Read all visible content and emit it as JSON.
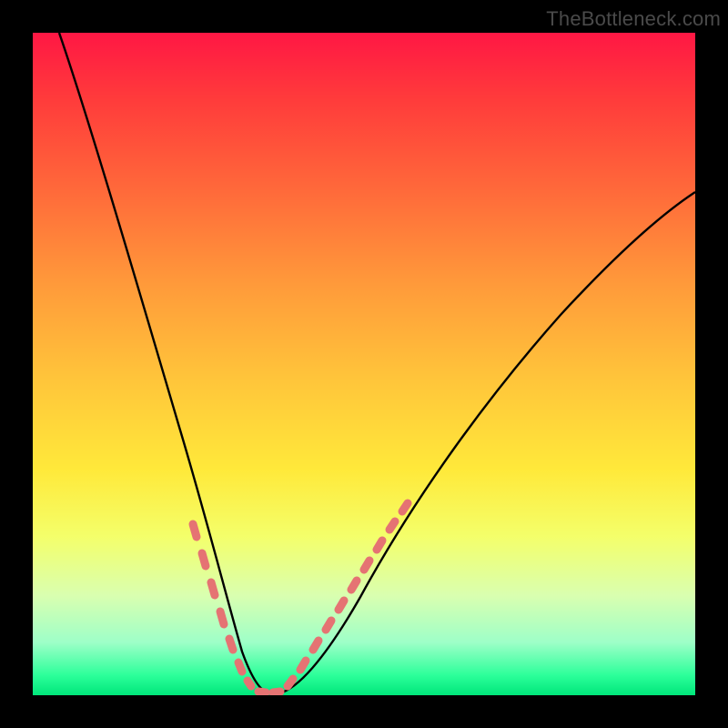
{
  "watermark": {
    "text": "TheBottleneck.com"
  },
  "chart_data": {
    "type": "line",
    "title": "",
    "xlabel": "",
    "ylabel": "",
    "xlim": [
      0,
      100
    ],
    "ylim": [
      0,
      100
    ],
    "grid": false,
    "legend": false,
    "series": [
      {
        "name": "bottleneck-curve",
        "description": "V-shaped curve; y represents bottleneck severity (0 = optimal / green band, 100 = worst / red band). Values estimated from gradient position.",
        "x": [
          4,
          8,
          12,
          16,
          20,
          24,
          27,
          29,
          31,
          33,
          35,
          37,
          43,
          48,
          56,
          64,
          72,
          80,
          88,
          96,
          100
        ],
        "y": [
          100,
          88,
          76,
          62,
          49,
          35,
          23,
          14,
          6,
          1,
          0,
          0,
          4,
          10,
          22,
          34,
          45,
          55,
          64,
          72,
          76
        ]
      }
    ],
    "highlight_band": {
      "description": "Salmon dashed dots overlaid on the curve in the lower (green/yellow) region, marking the near-optimal zone on both sides of the minimum.",
      "y_threshold_approx": 26,
      "x_range_left": [
        24,
        33
      ],
      "x_range_right": [
        37,
        58
      ]
    },
    "gradient_stops": [
      {
        "pos": 0.0,
        "color": "#ff1744"
      },
      {
        "pos": 0.1,
        "color": "#ff3b3b"
      },
      {
        "pos": 0.24,
        "color": "#ff6a3a"
      },
      {
        "pos": 0.38,
        "color": "#ff9a3a"
      },
      {
        "pos": 0.52,
        "color": "#ffc43a"
      },
      {
        "pos": 0.66,
        "color": "#ffe93a"
      },
      {
        "pos": 0.76,
        "color": "#f4ff6a"
      },
      {
        "pos": 0.85,
        "color": "#d9ffb0"
      },
      {
        "pos": 0.92,
        "color": "#9effc8"
      },
      {
        "pos": 0.97,
        "color": "#2cff9a"
      },
      {
        "pos": 1.0,
        "color": "#00e67a"
      }
    ]
  }
}
